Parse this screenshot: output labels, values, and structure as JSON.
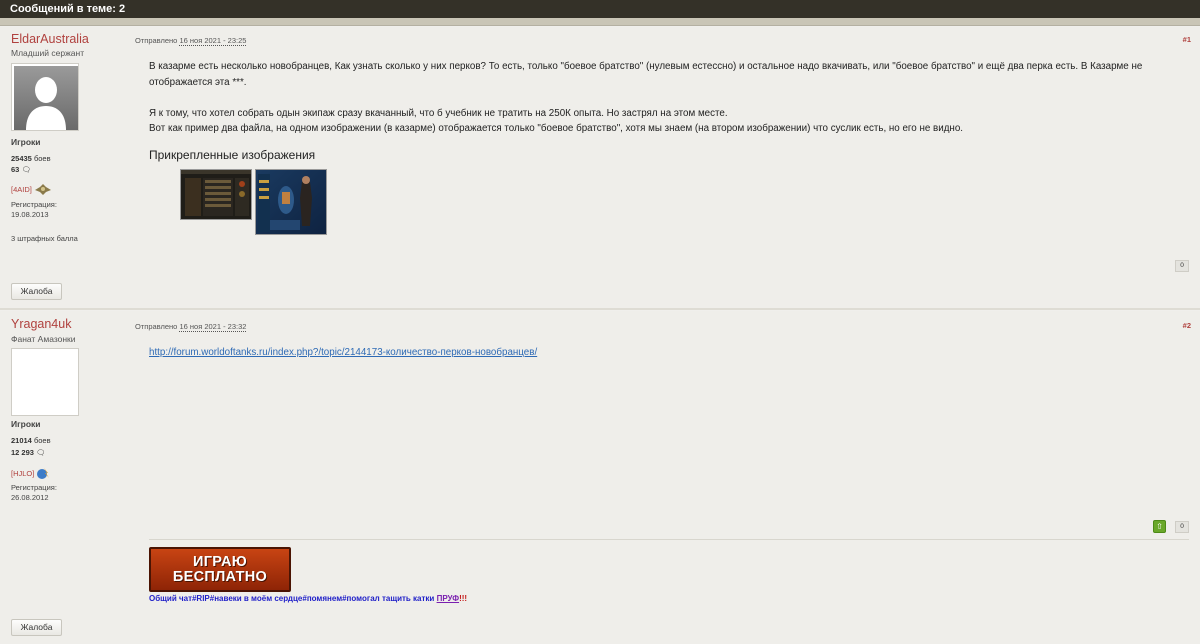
{
  "topbar": {
    "title": "Сообщений в теме: 2"
  },
  "posts": [
    {
      "author": "EldarAustralia",
      "rank": "Младший сержант",
      "group": "Игроки",
      "battles": "25435",
      "battles_label": "боев",
      "comments": "63",
      "clan": "[4AID]",
      "reg_label": "Регистрация:",
      "reg_date": "19.08.2013",
      "penalty": "3 штрафных балла",
      "report": "Жалоба",
      "sent_label": "Отправлено",
      "sent_date": "16 ноя 2021 - 23:25",
      "num": "#1",
      "text_p1": "В казарме есть несколько новобранцев, Как узнать сколько у них перков? То есть, только \"боевое братство\" (нулевым естессно)  и остальное надо вкачивать, или \"боевое братство\" и ещё два перка есть. В Казарме не отображается эта ***.",
      "text_p2a": "Я к тому, что хотел собрать одын экипаж сразу вкачанный, что б учебник не тратить на 250К опыта. Но застрял на этом месте.",
      "text_p2b": "Вот как пример два файла, на одном изображении (в казарме) отображается только \"боевое братство\", хотя мы знаем (на втором изображении) что суслик есть, но его не видно.",
      "attach_title": "Прикрепленные изображения",
      "rep": "0"
    },
    {
      "author": "Yragan4uk",
      "rank": "Фанат Амазонки",
      "group": "Игроки",
      "battles": "21014",
      "battles_label": "боев",
      "comments": "12 293",
      "clan": "[HJLO]",
      "reg_label": "Регистрация:",
      "reg_date": "26.08.2012",
      "report": "Жалоба",
      "sent_label": "Отправлено",
      "sent_date": "16 ноя 2021 - 23:32",
      "num": "#2",
      "link": "http://forum.worldoftanks.ru/index.php?/topic/2144173-количество-перков-новобранцев/",
      "rep": "0",
      "banner_line1": "ИГРАЮ",
      "banner_line2": "БЕСПЛАТНО",
      "signature": "Общий чат#RIP#навеки в моём сердце#помянем#помогал тащить катки",
      "signature_proof": "ПРУФ",
      "signature_bang": "!!!"
    }
  ],
  "colors": {
    "topbar": "#343128",
    "author": "#b0413e",
    "link": "#2e6ab5",
    "page_bg": "#efeeea"
  }
}
